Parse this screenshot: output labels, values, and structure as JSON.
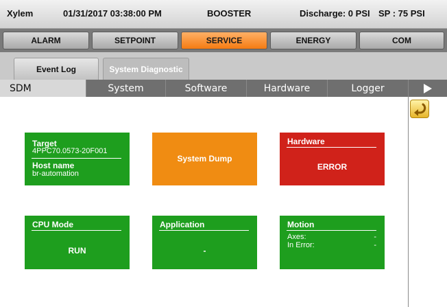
{
  "header": {
    "brand": "Xylem",
    "datetime": "01/31/2017 03:38:00 PM",
    "mode": "BOOSTER",
    "discharge": "Discharge: 0 PSI",
    "setpoint": "SP : 75 PSI"
  },
  "nav": {
    "items": [
      "ALARM",
      "SETPOINT",
      "SERVICE",
      "ENERGY",
      "COM"
    ],
    "active": "SERVICE",
    "accent_color": "#f57b12"
  },
  "subtabs": {
    "items": [
      "Event Log",
      "System Diagnostic"
    ],
    "active": "System Diagnostic"
  },
  "sections": {
    "items": [
      "SDM",
      "System",
      "Software",
      "Hardware",
      "Logger"
    ],
    "active": "SDM",
    "more_icon": "triangle-right-icon"
  },
  "back_icon": "return-arrow-icon",
  "tiles": {
    "target": {
      "title": "Target",
      "value": "4PPC70.0573-20F001",
      "host_label": "Host name",
      "host_value": "br-automation",
      "color": "#1e9e1e"
    },
    "dump": {
      "label": "System Dump",
      "color": "#f08c12"
    },
    "hardware": {
      "title": "Hardware",
      "status": "ERROR",
      "color": "#d0221a"
    },
    "cpu": {
      "title": "CPU Mode",
      "status": "RUN",
      "color": "#1e9e1e"
    },
    "application": {
      "title": "Application",
      "status": "-",
      "color": "#1e9e1e"
    },
    "motion": {
      "title": "Motion",
      "axes_label": "Axes:",
      "axes_value": "-",
      "error_label": "In Error:",
      "error_value": "-",
      "color": "#1e9e1e"
    }
  }
}
